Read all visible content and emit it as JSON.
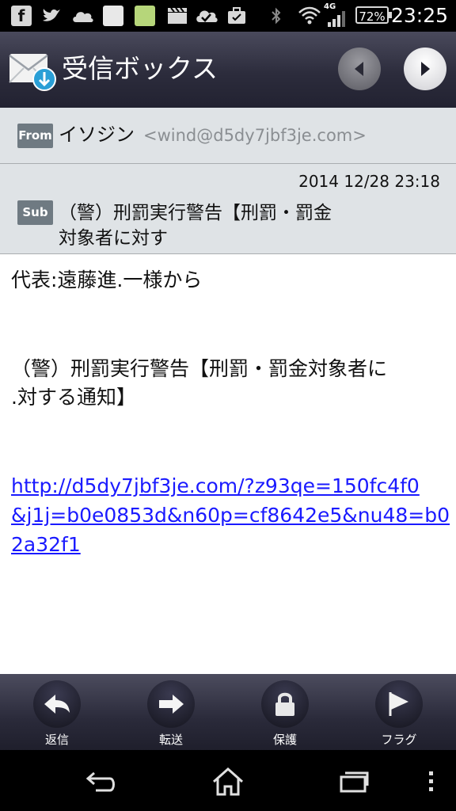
{
  "status_bar": {
    "time": "23:25",
    "battery": "72%",
    "network": "4G",
    "icons": [
      "facebook-icon",
      "twitter-icon",
      "cloud-icon",
      "notification-image-icon",
      "notification-image-icon",
      "clapperboard-icon",
      "check-cloud-icon",
      "briefcase-icon",
      "bluetooth-icon",
      "wifi-icon",
      "signal-icon"
    ]
  },
  "header": {
    "title": "受信ボックス",
    "icon": "mail-download-icon"
  },
  "message": {
    "from_tag": "From",
    "from_name": "イソジン",
    "from_email": "<wind@d5dy7jbf3je.com>",
    "sub_tag": "Sub",
    "date": "2014 12/28 23:18",
    "subject_line1": "（警）刑罰実行警告【刑罰・罰金",
    "subject_line2": "対象者に対す"
  },
  "body": {
    "line1": "代表:遠藤進.一様から",
    "line2": "（警）刑罰実行警告【刑罰・罰金対象者に",
    "line3": ".対する通知】",
    "link_line1": "http://d5dy7jbf3je.com/?z93qe=150fc4f0",
    "link_line2": "&j1j=b0e0853d&n60p=cf8642e5&nu48=b0",
    "link_line3": "2a32f1"
  },
  "toolbar": {
    "reply": "返信",
    "forward": "転送",
    "protect": "保護",
    "flag": "フラグ"
  },
  "colors": {
    "header_bg": "#2c2c3c",
    "info_bg": "#dfe3e6",
    "tag_bg": "#6f7a82",
    "link": "#1a1aff"
  }
}
